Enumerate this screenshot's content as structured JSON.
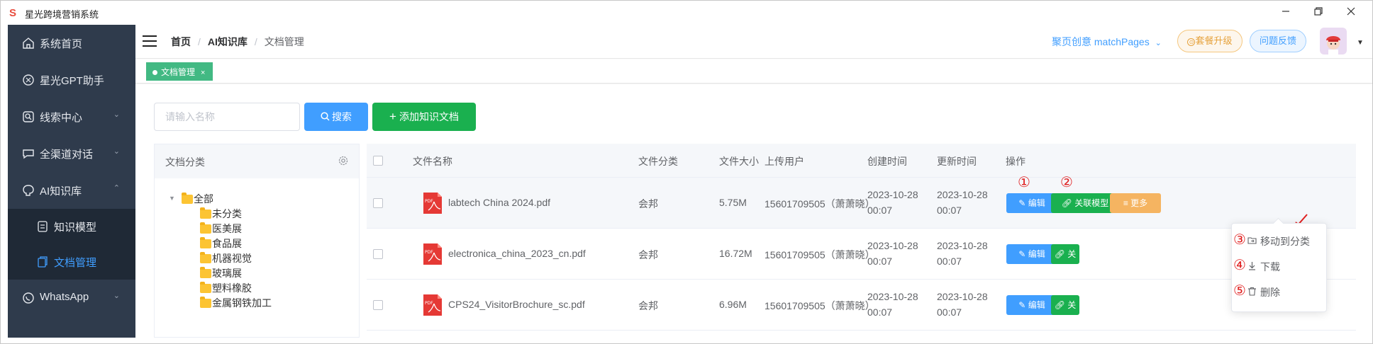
{
  "app": {
    "title": "星光跨境营销系统",
    "logo": "S"
  },
  "sidebar": {
    "items": [
      {
        "label": "系统首页",
        "icon": "home-icon"
      },
      {
        "label": "星光GPT助手",
        "icon": "gpt-icon"
      },
      {
        "label": "线索中心",
        "icon": "clue-icon"
      },
      {
        "label": "全渠道对话",
        "icon": "chat-icon"
      },
      {
        "label": "AI知识库",
        "icon": "brain-icon"
      },
      {
        "label": "WhatsApp",
        "icon": "whatsapp-icon"
      }
    ],
    "sub_items": [
      {
        "label": "知识模型",
        "icon": "model-icon"
      },
      {
        "label": "文档管理",
        "icon": "document-icon",
        "active": true
      }
    ]
  },
  "header": {
    "breadcrumb": [
      "首页",
      "AI知识库",
      "文档管理"
    ],
    "workspace": "聚页创意 matchPages",
    "upgrade": "套餐升级",
    "feedback": "问题反馈"
  },
  "tabs": [
    {
      "label": "文档管理",
      "close": "×"
    }
  ],
  "toolbar": {
    "search_placeholder": "请输入名称",
    "search_button": "搜索",
    "add_button": "添加知识文档"
  },
  "category_panel": {
    "title": "文档分类",
    "tree": {
      "root": "全部",
      "children": [
        "未分类",
        "医美展",
        "食品展",
        "机器视觉",
        "玻璃展",
        "塑料橡胶",
        "金属钢铁加工"
      ]
    }
  },
  "table": {
    "columns": [
      "文件名称",
      "文件分类",
      "文件大小",
      "上传用户",
      "创建时间",
      "更新时间",
      "操作"
    ],
    "rows": [
      {
        "name": "labtech China 2024.pdf",
        "category": "会邦",
        "size": "5.75M",
        "user": "15601709505（萧萧晓）",
        "created": [
          "2023-10-28",
          "00:07"
        ],
        "updated": [
          "2023-10-28",
          "00:07"
        ]
      },
      {
        "name": "electronica_china_2023_cn.pdf",
        "category": "会邦",
        "size": "16.72M",
        "user": "15601709505（萧萧晓）",
        "created": [
          "2023-10-28",
          "00:07"
        ],
        "updated": [
          "2023-10-28",
          "00:07"
        ]
      },
      {
        "name": "CPS24_VisitorBrochure_sc.pdf",
        "category": "会邦",
        "size": "6.96M",
        "user": "15601709505（萧萧晓）",
        "created": [
          "2023-10-28",
          "00:07"
        ],
        "updated": [
          "2023-10-28",
          "00:07"
        ]
      }
    ],
    "actions": {
      "edit": "编辑",
      "link": "关联模型",
      "more": "更多",
      "link_partial": "关"
    }
  },
  "dropdown": {
    "items": [
      {
        "num": "③",
        "label": "移动到分类",
        "icon": "folder-move-icon"
      },
      {
        "num": "④",
        "label": "下载",
        "icon": "download-icon"
      },
      {
        "num": "⑤",
        "label": "删除",
        "icon": "trash-icon"
      }
    ]
  },
  "markers": {
    "edit": "①",
    "link": "②"
  },
  "colors": {
    "primary": "#409eff",
    "success": "#1ab04f",
    "warning": "#f5b461",
    "sidebar": "#2f3b4c",
    "marker": "#e02020"
  }
}
